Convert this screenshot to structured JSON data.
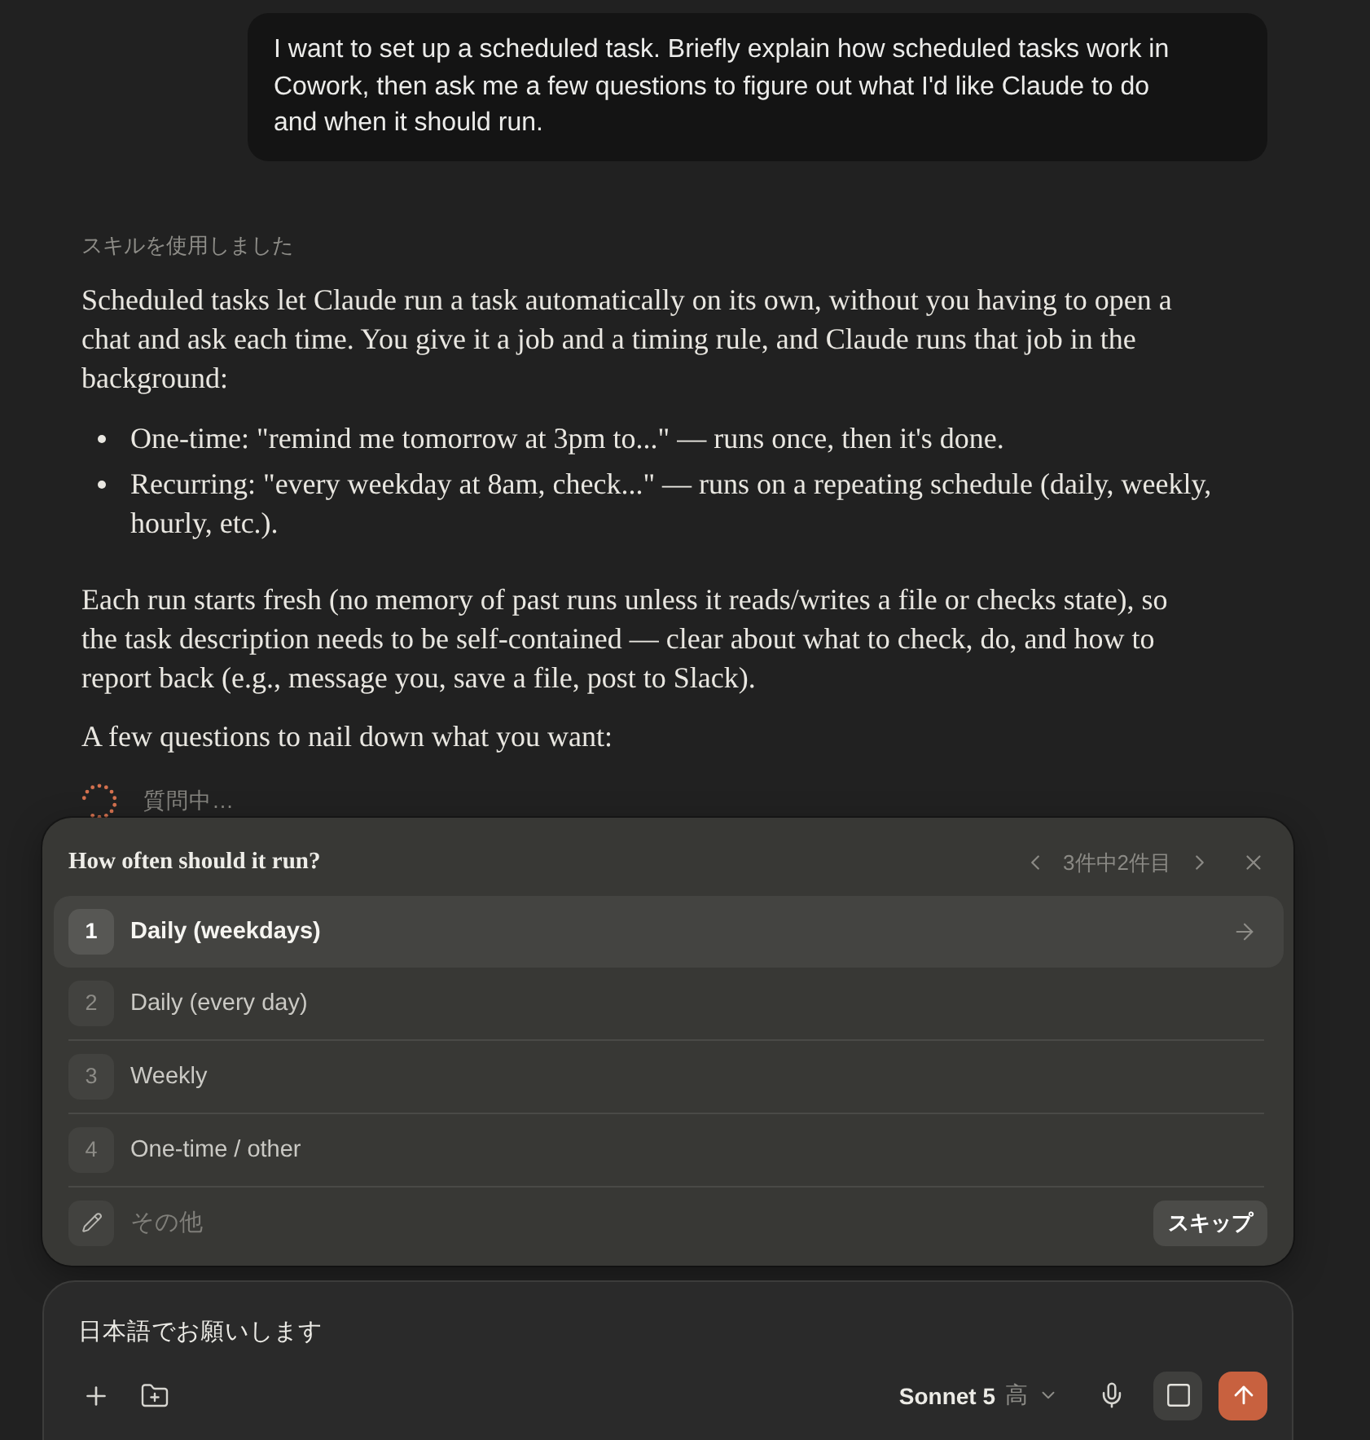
{
  "user_message": {
    "text": "I want to set up a scheduled task. Briefly explain how scheduled tasks work in Cowork, then ask me a few questions to figure out what I'd like Claude to do and when it should run."
  },
  "assistant": {
    "skill_note": "スキルを使用しました",
    "blocks": [
      {
        "kind": "paragraph",
        "text": "Scheduled tasks let Claude run a task automatically on its own, without you having to open a chat and ask each time. You give it a job and a timing rule, and Claude runs that job in the background:"
      },
      {
        "kind": "list",
        "items": [
          "One-time: \"remind me tomorrow at 3pm to...\" — runs once, then it's done.",
          "Recurring: \"every weekday at 8am, check...\" — runs on a repeating schedule (daily, weekly, hourly, etc.)."
        ]
      },
      {
        "kind": "paragraph",
        "text": "Each run starts fresh (no memory of past runs unless it reads/writes a file or checks state), so the task description needs to be self-contained — clear about what to check, do, and how to report back (e.g., message you, save a file, post to Slack)."
      },
      {
        "kind": "paragraph",
        "text": "A few questions to nail down what you want:"
      }
    ],
    "status": "質問中…"
  },
  "question_card": {
    "question": "How often should it run?",
    "pager": "3件中2件目",
    "options": [
      {
        "number": "1",
        "label": "Daily (weekdays)",
        "selected": true
      },
      {
        "number": "2",
        "label": "Daily (every day)",
        "selected": false
      },
      {
        "number": "3",
        "label": "Weekly",
        "selected": false
      },
      {
        "number": "4",
        "label": "One-time / other",
        "selected": false
      }
    ],
    "other": {
      "placeholder": "その他"
    },
    "skip_button": "スキップ"
  },
  "composer": {
    "value": "日本語でお願いします",
    "model": "Sonnet 5",
    "effort": "高"
  }
}
